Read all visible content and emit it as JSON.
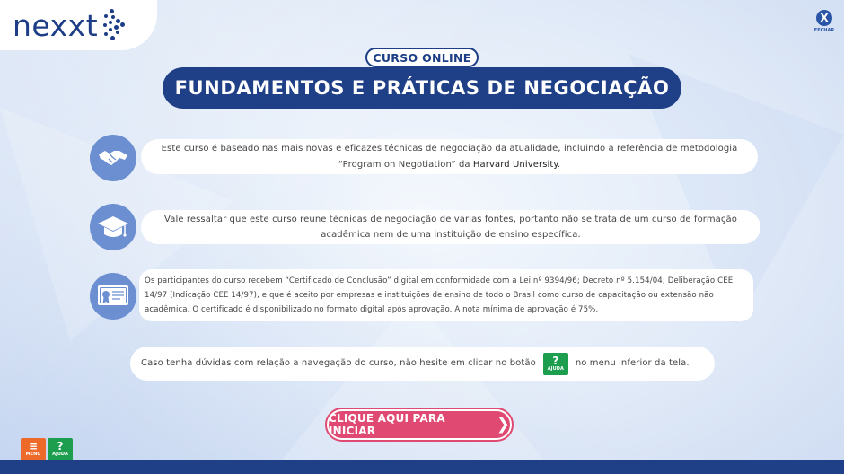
{
  "brand": {
    "logo_text": "nexxt"
  },
  "header": {
    "close_icon_glyph": "X",
    "close_label": "FECHAR",
    "kicker": "CURSO ONLINE",
    "title": "FUNDAMENTOS E PRÁTICAS DE NEGOCIAÇÃO"
  },
  "items": [
    {
      "icon": "handshake-icon",
      "text_a": "Este curso é baseado nas mais novas e eficazes técnicas de negociação da atualidade, incluindo a referência de metodologia “Program on Negotiation” da ",
      "text_b": "Harvard University",
      "text_c": "."
    },
    {
      "icon": "graduation-cap-icon",
      "text": "Vale ressaltar que este curso reúne técnicas de negociação de várias fontes, portanto não se trata de um curso de formação acadêmica nem de uma instituição de ensino específica."
    },
    {
      "icon": "certificate-icon",
      "text": "Os participantes do curso recebem “Certificado de Conclusão” digital em conformidade com a Lei nº 9394/96; Decreto nº 5.154/04; Deliberação CEE 14/97 (Indicação CEE 14/97), e que é aceito por empresas e instituições de ensino de todo o Brasil como curso de capacitação ou extensão não acadêmica. O certificado é disponibilizado no formato digital após aprovação. A nota mínima de aprovação é 75%."
    }
  ],
  "help_note": {
    "before": "Caso tenha dúvidas com relação a navegação do curso, não hesite em clicar no botão",
    "after": "no menu inferior da tela.",
    "button_glyph": "?",
    "button_label": "AJUDA"
  },
  "start_button": {
    "label": "CLIQUE AQUI PARA INICIAR",
    "chevron": "❯"
  },
  "bottom_nav": {
    "menu_glyph": "≡",
    "menu_label": "MENU",
    "help_glyph": "?",
    "help_label": "AJUDA"
  },
  "colors": {
    "navy": "#1f3f87",
    "icon_blue": "#6b8fd1",
    "pink": "#e04a72",
    "green": "#1d9e4f",
    "orange": "#ee6a2b"
  }
}
